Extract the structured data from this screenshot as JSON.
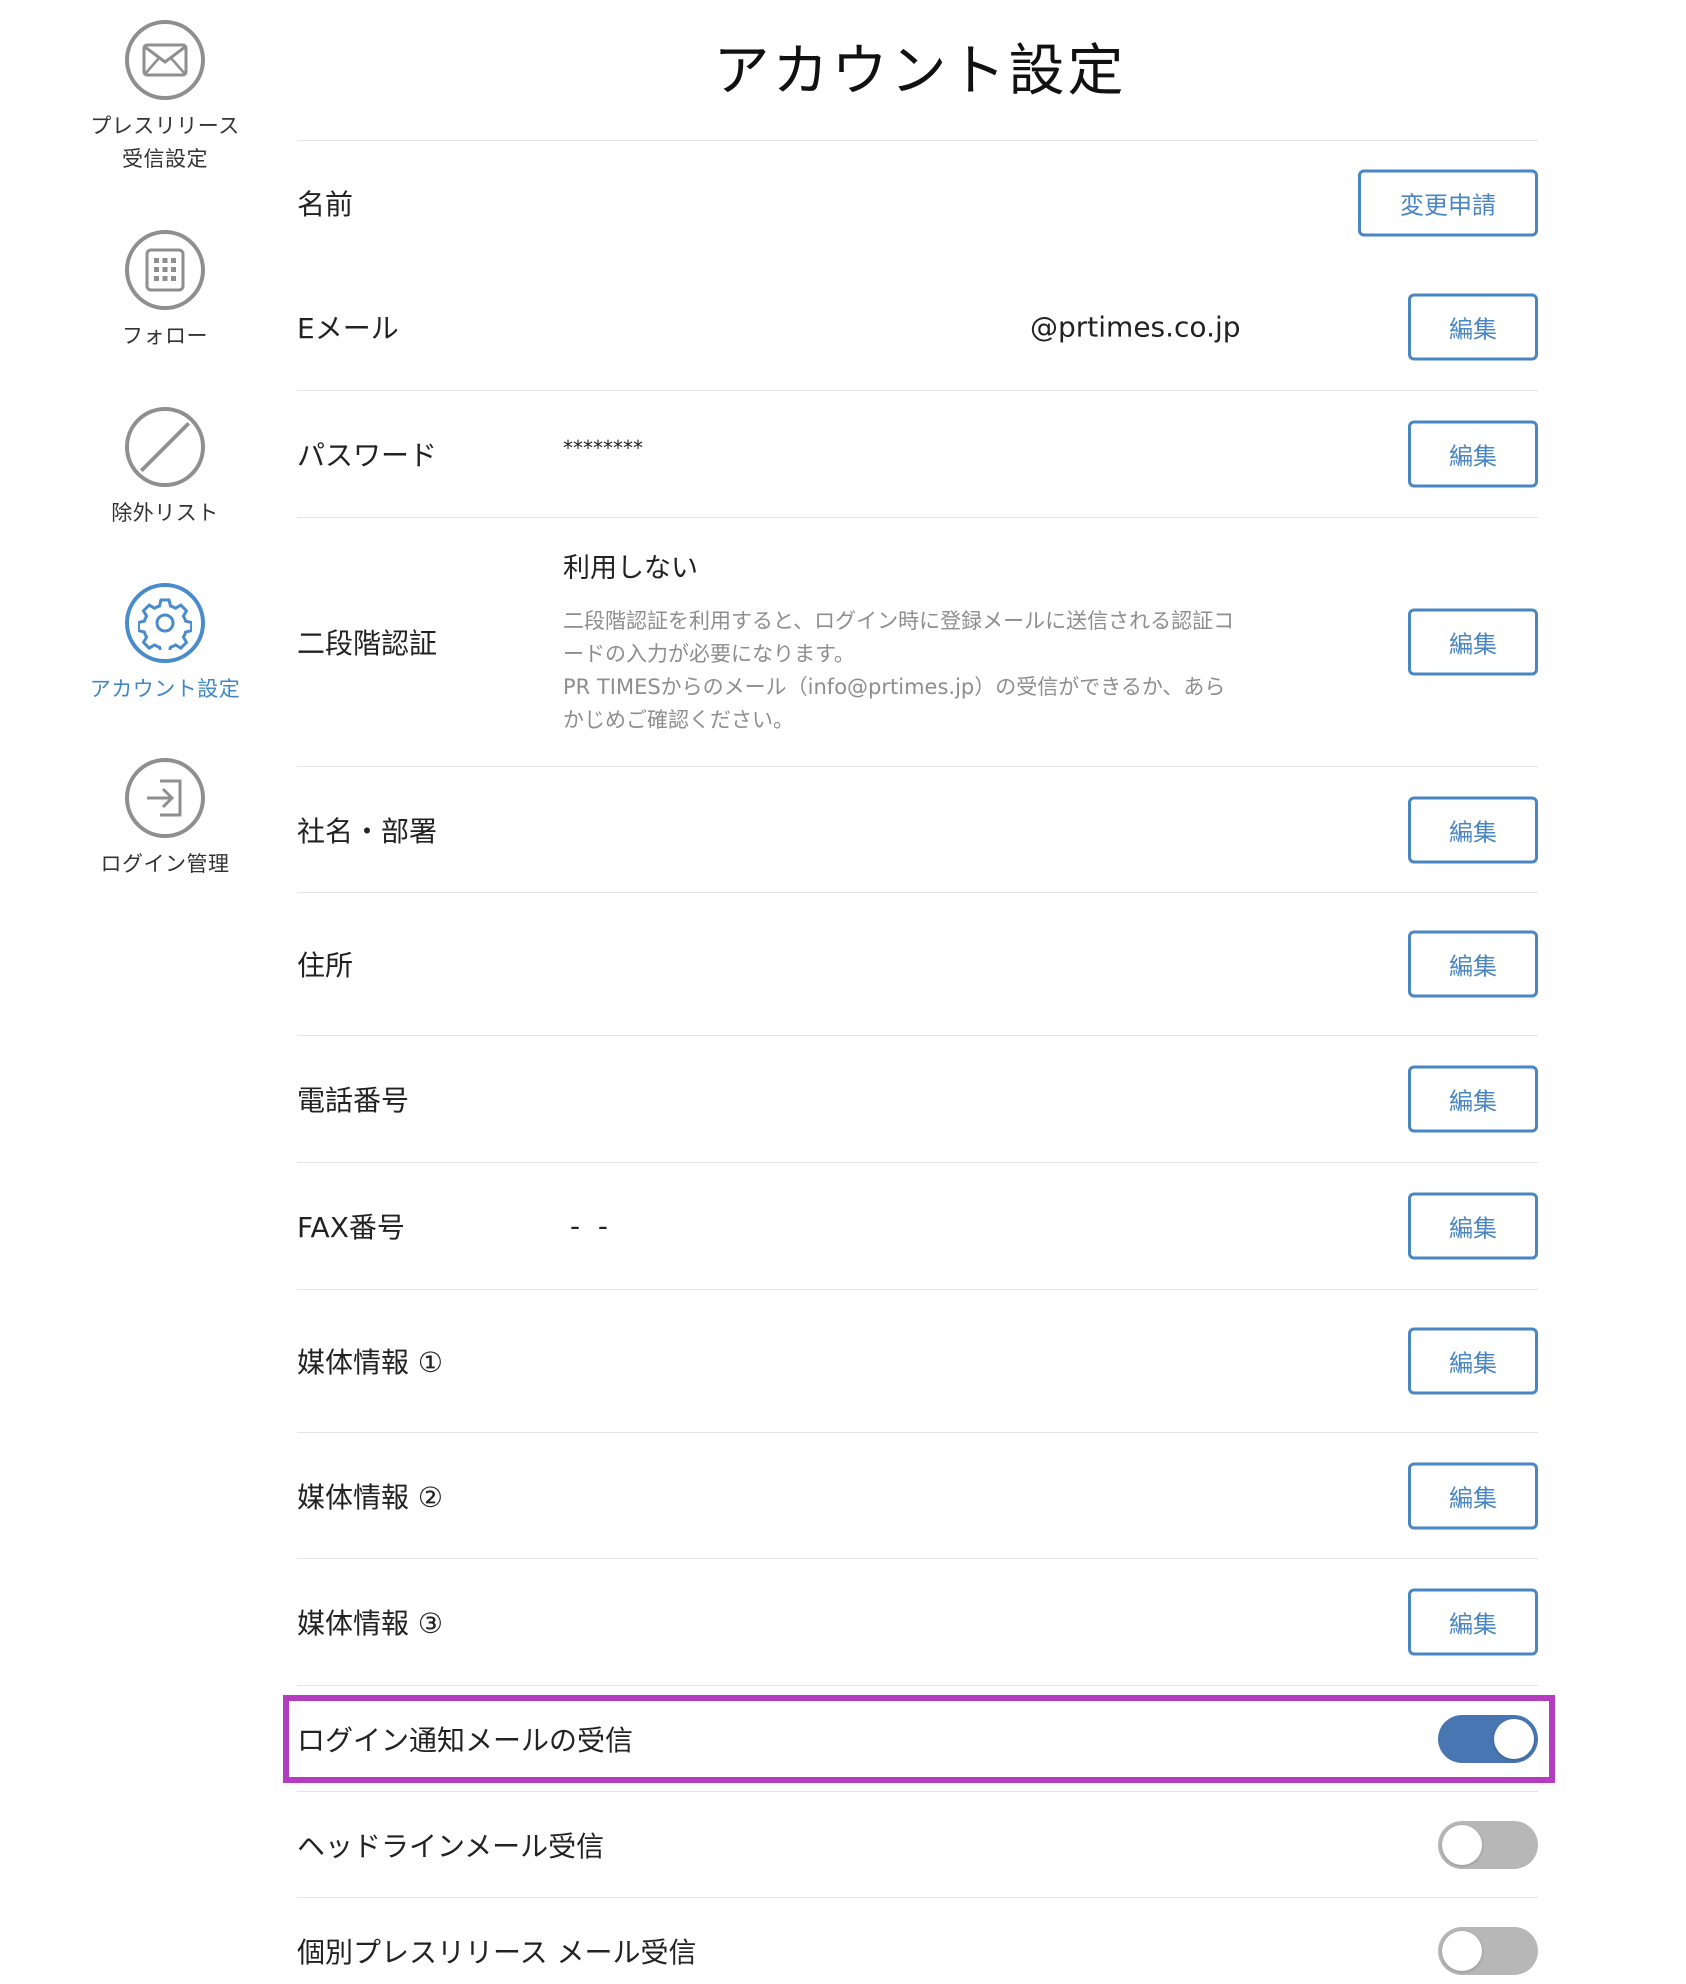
{
  "sidebar": {
    "items": [
      {
        "label_line1": "プレスリリース",
        "label_line2": "受信設定",
        "icon": "envelope-icon",
        "active": false
      },
      {
        "label": "フォロー",
        "icon": "building-icon",
        "active": false
      },
      {
        "label": "除外リスト",
        "icon": "prohibited-icon",
        "active": false
      },
      {
        "label": "アカウント設定",
        "icon": "gear-icon",
        "active": true
      },
      {
        "label": "ログイン管理",
        "icon": "login-icon",
        "active": false
      }
    ]
  },
  "page": {
    "title": "アカウント設定"
  },
  "settings": {
    "name": {
      "label": "名前",
      "button": "変更申請"
    },
    "email": {
      "label": "Eメール",
      "value": "@prtimes.co.jp",
      "button": "編集"
    },
    "password": {
      "label": "パスワード",
      "value": "********",
      "button": "編集"
    },
    "twofa": {
      "label": "二段階認証",
      "status": "利用しない",
      "desc_line1": "二段階認証を利用すると、ログイン時に登録メールに送信される認証コ",
      "desc_line2": "ードの入力が必要になります。",
      "desc_line3": " PR TIMESからのメール（info@prtimes.jp）の受信ができるか、あら",
      "desc_line4": "かじめご確認ください。",
      "button": "編集"
    },
    "company": {
      "label": "社名・部署",
      "button": "編集"
    },
    "address": {
      "label": "住所",
      "button": "編集"
    },
    "phone": {
      "label": "電話番号",
      "button": "編集"
    },
    "fax": {
      "label": "FAX番号",
      "value": "-  -",
      "button": "編集"
    },
    "media1": {
      "label": "媒体情報 ①",
      "button": "編集"
    },
    "media2": {
      "label": "媒体情報 ②",
      "button": "編集"
    },
    "media3": {
      "label": "媒体情報 ③",
      "button": "編集"
    },
    "login_notify": {
      "label": "ログイン通知メールの受信",
      "enabled": true
    },
    "headline": {
      "label": "ヘッドラインメール受信",
      "enabled": false
    },
    "individual": {
      "label": "個別プレスリリース メール受信",
      "enabled": false
    }
  },
  "colors": {
    "accent": "#4a86c2",
    "toggle_on": "#4876b3",
    "toggle_off": "#b7b7b7",
    "highlight": "#b43cc1"
  }
}
